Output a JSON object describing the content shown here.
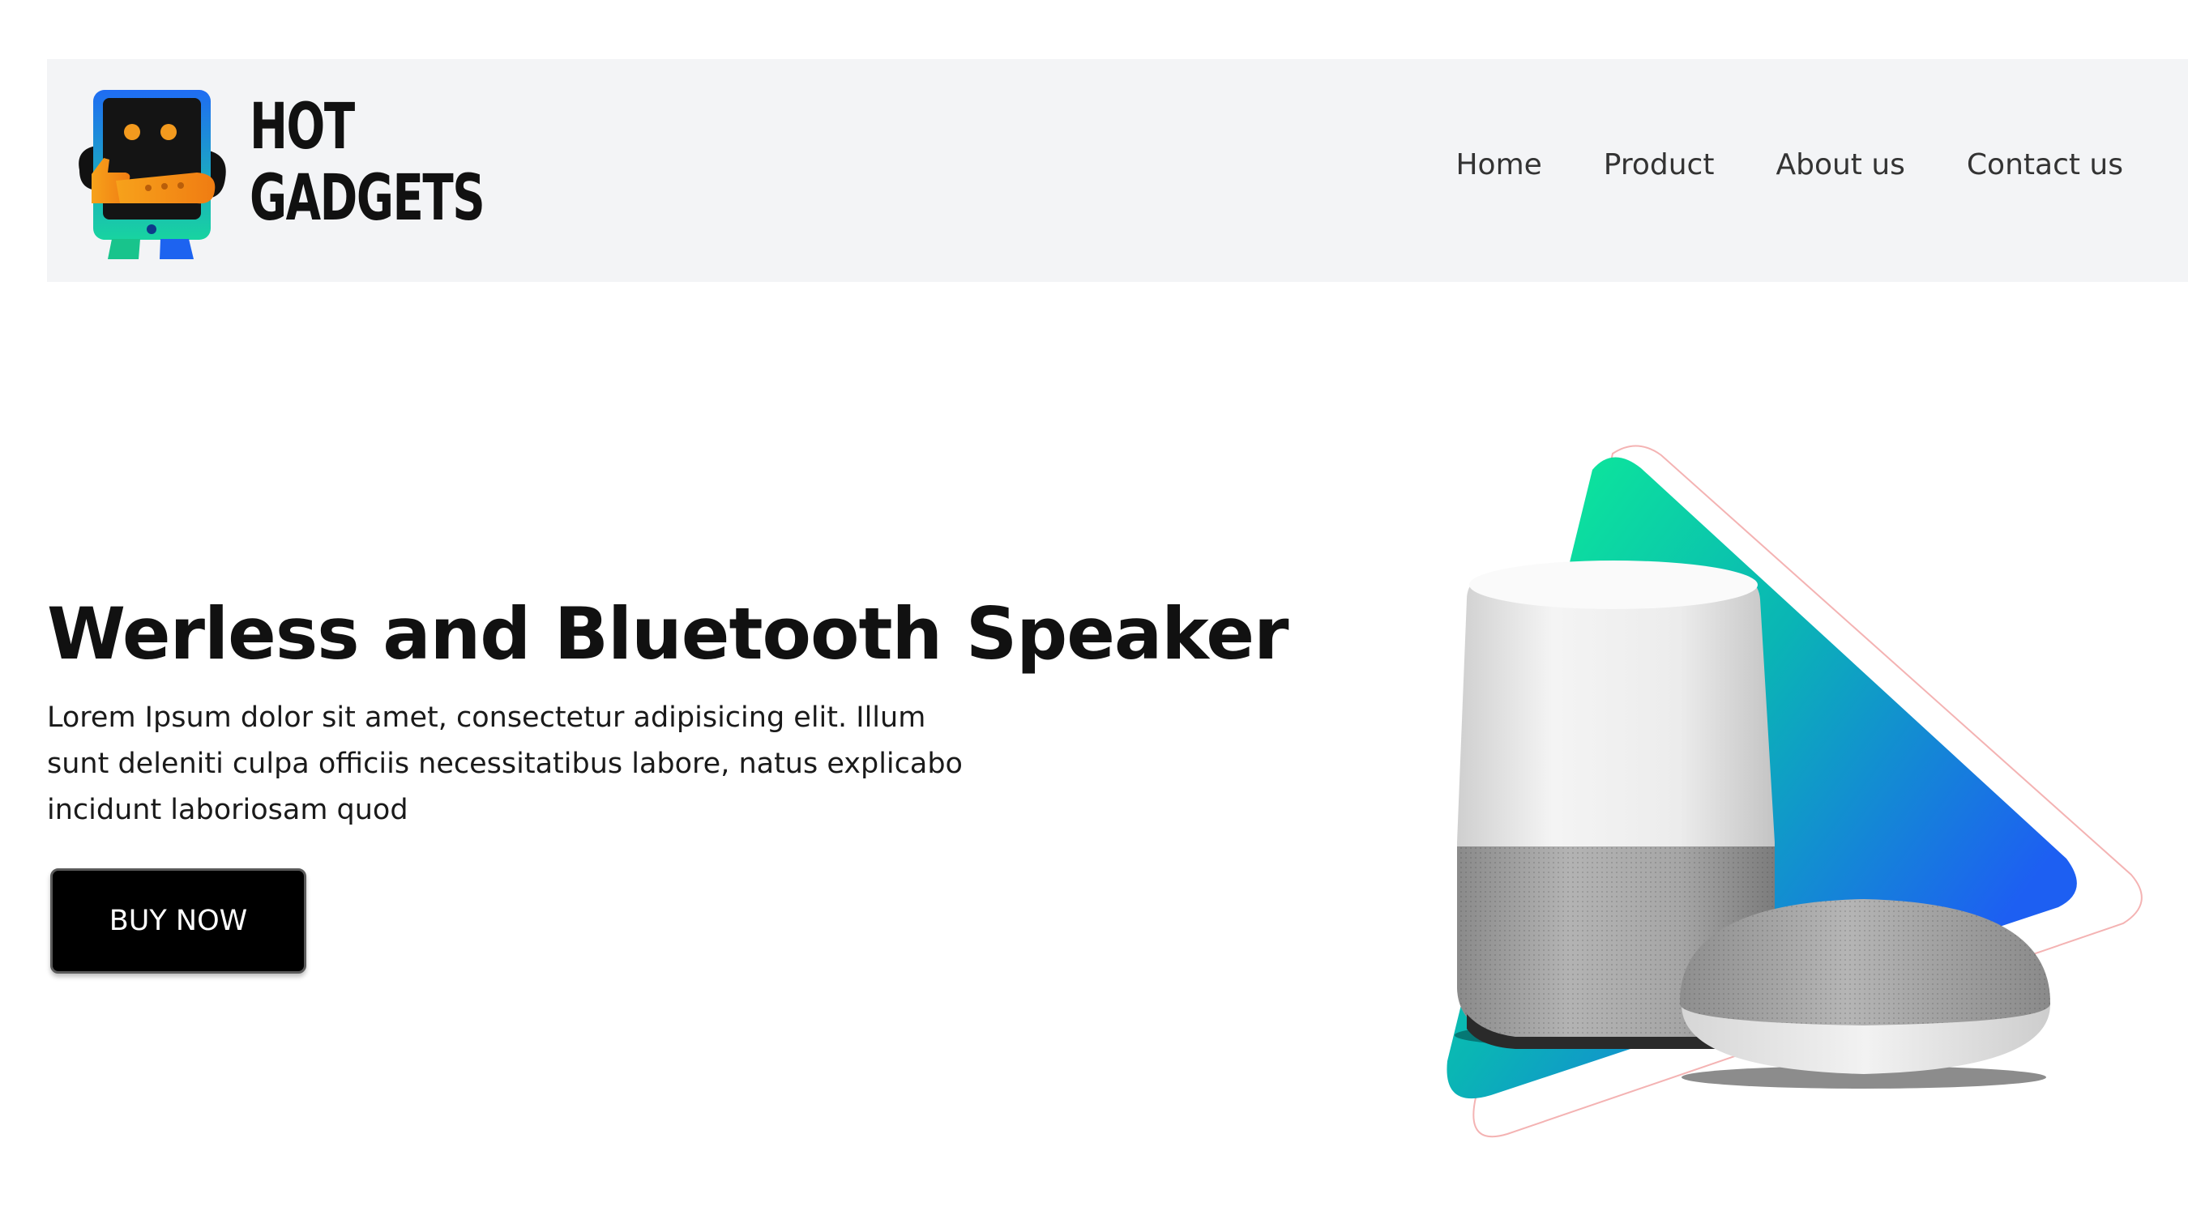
{
  "brand": {
    "name": "HOT\nGADGETS"
  },
  "nav": {
    "items": [
      {
        "label": "Home"
      },
      {
        "label": "Product"
      },
      {
        "label": "About us"
      },
      {
        "label": "Contact us"
      }
    ]
  },
  "hero": {
    "title": "Werless and Bluetooth Speaker",
    "description": "Lorem Ipsum dolor sit amet, consectetur adipisicing elit. Illum sunt deleniti culpa officiis necessitatibus labore, natus explicabo incidunt laboriosam quod",
    "cta_label": "BUY NOW"
  },
  "colors": {
    "header_bg": "#f3f4f6",
    "gradient_start": "#0de89a",
    "gradient_end": "#1d63f0",
    "button_bg": "#000000"
  },
  "icons": {
    "logo": "robot-mascot-icon"
  }
}
